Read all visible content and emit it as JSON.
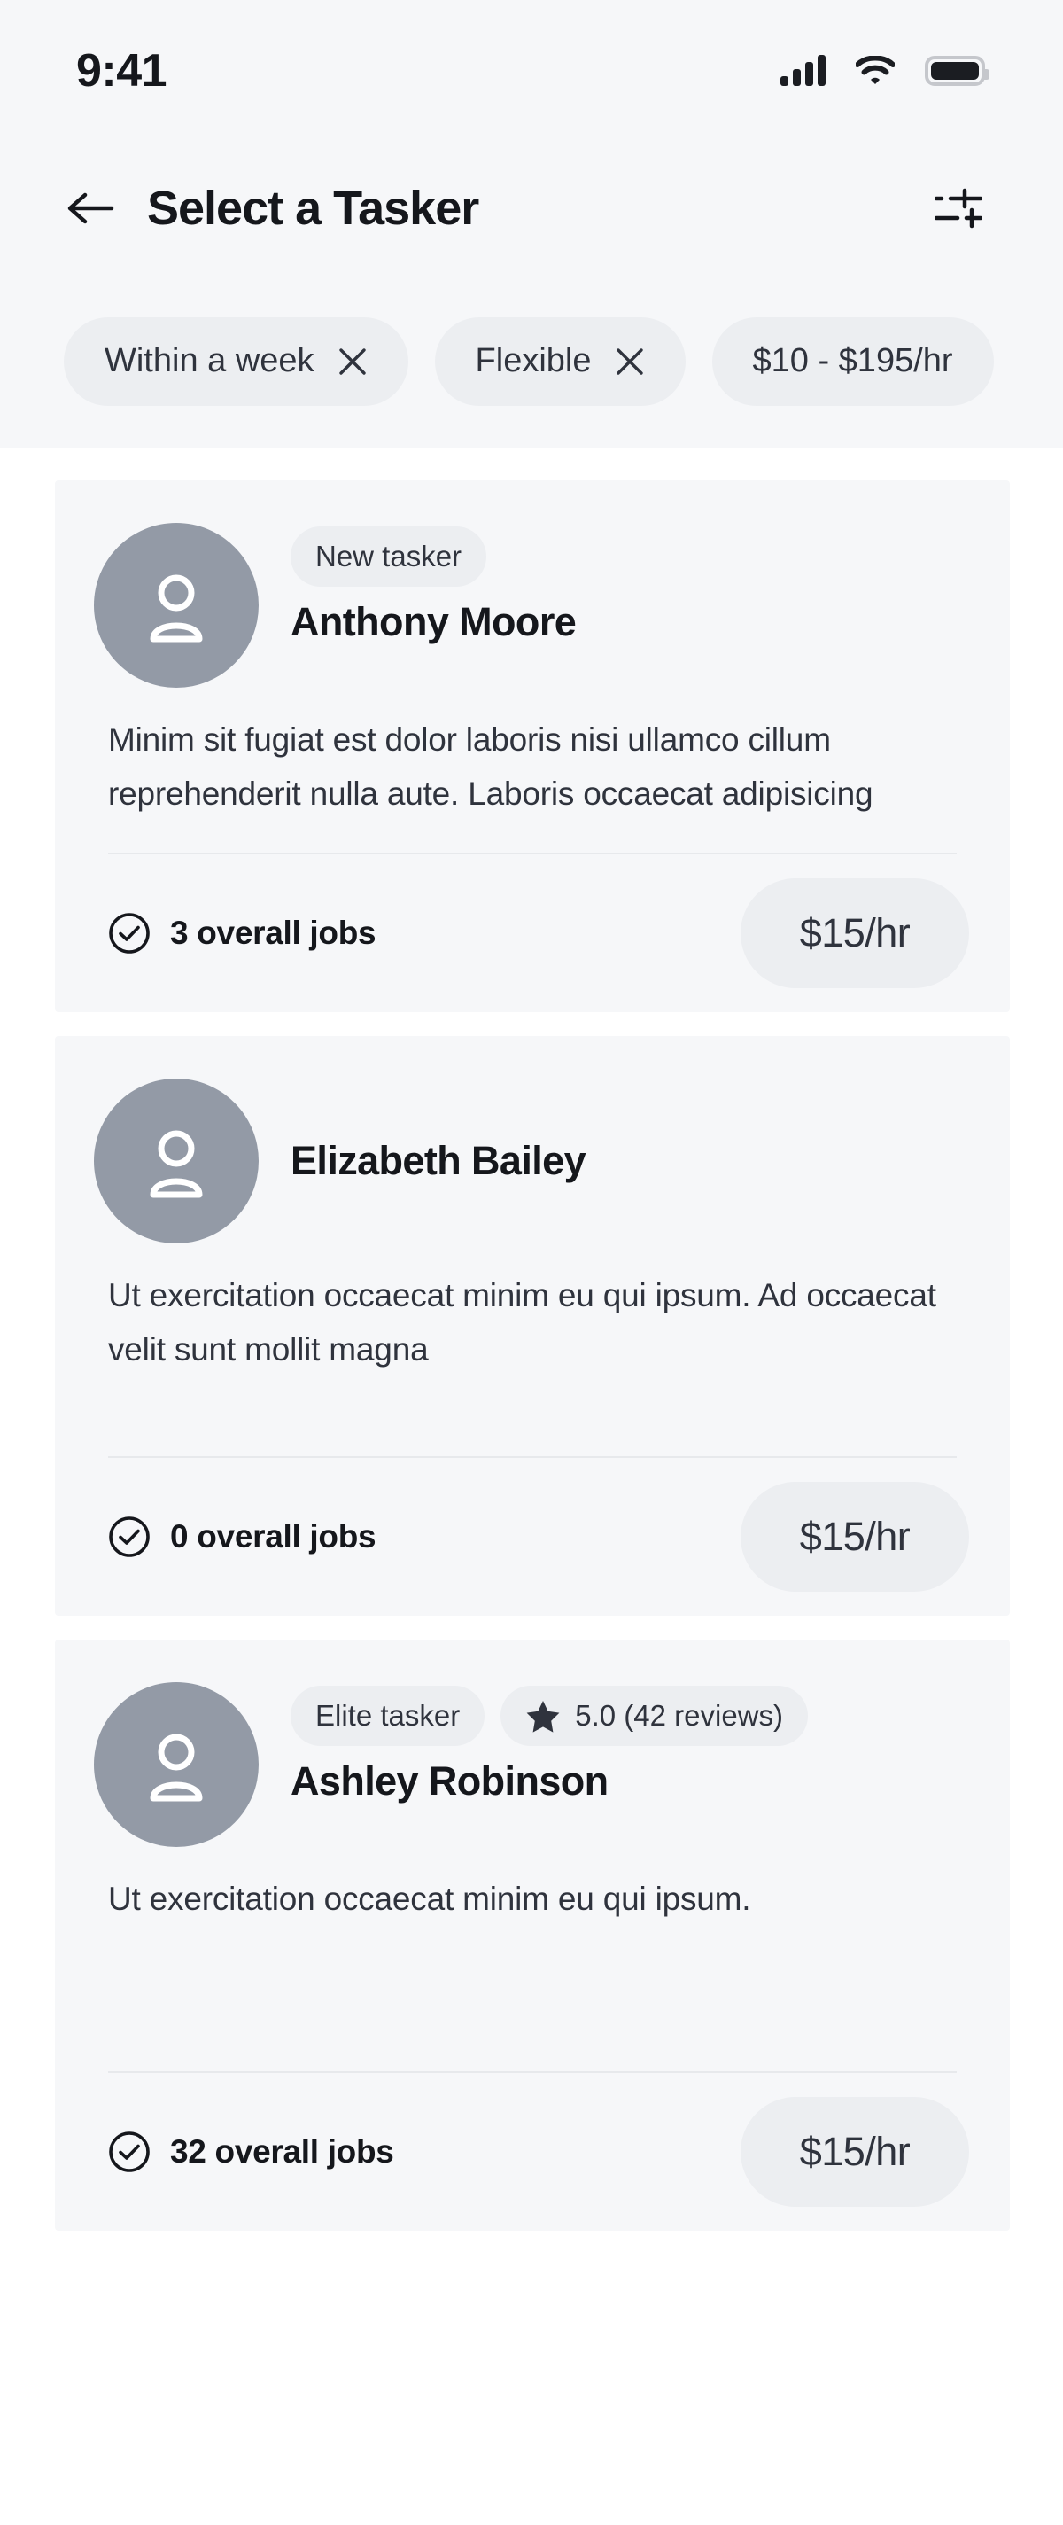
{
  "status_bar": {
    "time": "9:41",
    "signal_icon": "signal-bars-icon",
    "wifi_icon": "wifi-icon",
    "battery_icon": "battery-full-icon"
  },
  "header": {
    "back_icon": "arrow-left-icon",
    "title": "Select a Tasker",
    "filter_icon": "sliders-filter-icon"
  },
  "filters": {
    "chips": [
      {
        "label": "Within a week",
        "removable": true,
        "remove_icon": "close-icon"
      },
      {
        "label": "Flexible",
        "removable": true,
        "remove_icon": "close-icon"
      },
      {
        "label": "$10 - $195/hr",
        "removable": false,
        "remove_icon": ""
      }
    ]
  },
  "taskers": [
    {
      "avatar_icon": "user-avatar-icon",
      "badges": [
        {
          "text": "New tasker",
          "icon": ""
        }
      ],
      "name": "Anthony Moore",
      "description": "Minim sit fugiat est dolor laboris nisi ullamco cillum reprehenderit nulla aute. Laboris occaecat adipisicing",
      "jobs_icon": "check-circle-icon",
      "jobs_text": "3 overall jobs",
      "price": "$15/hr"
    },
    {
      "avatar_icon": "user-avatar-icon",
      "badges": [],
      "name": "Elizabeth Bailey",
      "description": "Ut exercitation occaecat minim eu qui ipsum. Ad occaecat velit sunt mollit magna",
      "jobs_icon": "check-circle-icon",
      "jobs_text": "0 overall jobs",
      "price": "$15/hr"
    },
    {
      "avatar_icon": "user-avatar-icon",
      "badges": [
        {
          "text": "Elite tasker",
          "icon": ""
        },
        {
          "text": "5.0 (42 reviews)",
          "icon": "star-icon"
        }
      ],
      "name": "Ashley Robinson",
      "description": "Ut exercitation occaecat minim eu qui ipsum.",
      "jobs_icon": "check-circle-icon",
      "jobs_text": "32 overall jobs",
      "price": "$15/hr"
    }
  ],
  "colors": {
    "screen_background": "#ffffff",
    "chrome_background": "#f6f7f9",
    "card_background": "#f6f7f9",
    "pill_background": "#eceef1",
    "avatar_background": "#939aa6",
    "text_primary": "#15171c",
    "text_secondary": "#2f333d",
    "divider": "#e7e9ec"
  }
}
